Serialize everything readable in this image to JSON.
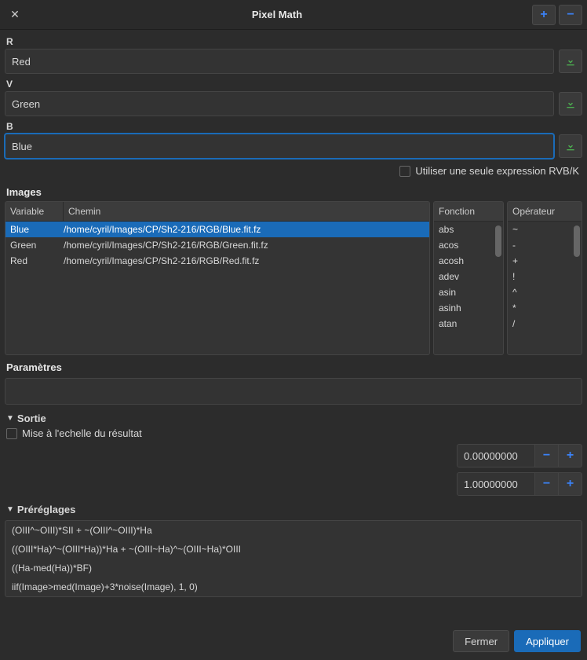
{
  "titlebar": {
    "title": "Pixel Math"
  },
  "channels": {
    "r": {
      "label": "R",
      "value": "Red"
    },
    "g": {
      "label": "V",
      "value": "Green"
    },
    "b": {
      "label": "B",
      "value": "Blue"
    }
  },
  "use_single_expr_label": "Utiliser une seule expression RVB/K",
  "images": {
    "title": "Images",
    "headers": {
      "variable": "Variable",
      "path": "Chemin",
      "function": "Fonction",
      "operator": "Opérateur"
    },
    "rows": [
      {
        "variable": "Blue",
        "path": "/home/cyril/Images/CP/Sh2-216/RGB/Blue.fit.fz",
        "selected": true
      },
      {
        "variable": "Green",
        "path": "/home/cyril/Images/CP/Sh2-216/RGB/Green.fit.fz",
        "selected": false
      },
      {
        "variable": "Red",
        "path": "/home/cyril/Images/CP/Sh2-216/RGB/Red.fit.fz",
        "selected": false
      }
    ],
    "functions": [
      "abs",
      "acos",
      "acosh",
      "adev",
      "asin",
      "asinh",
      "atan"
    ],
    "operators": [
      "~",
      "-",
      "+",
      "!",
      "^",
      "*",
      "/"
    ]
  },
  "parameters": {
    "title": "Paramètres"
  },
  "output": {
    "title": "Sortie",
    "rescale_label": "Mise à l'echelle du résultat",
    "low": "0.00000000",
    "high": "1.00000000"
  },
  "presets": {
    "title": "Préréglages",
    "items": [
      "(OIII^~OIII)*SII + ~(OIII^~OIII)*Ha",
      "((OIII*Ha)^~(OIII*Ha))*Ha + ~(OIII~Ha)^~(OIII~Ha)*OIII",
      "((Ha-med(Ha))*BF)",
      "iif(Image>med(Image)+3*noise(Image), 1, 0)"
    ]
  },
  "footer": {
    "close": "Fermer",
    "apply": "Appliquer"
  }
}
